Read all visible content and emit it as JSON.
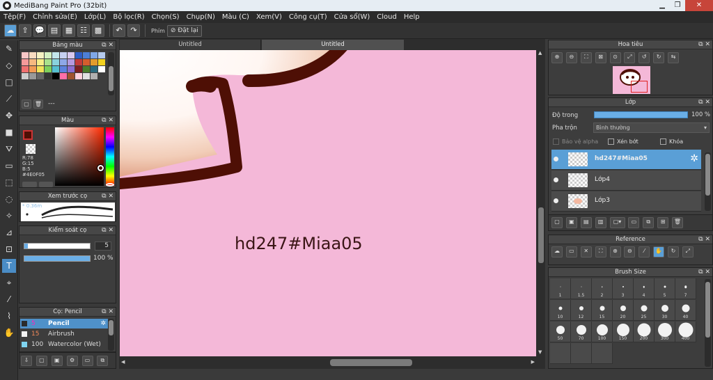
{
  "app": {
    "title": "MediBang Paint Pro (32bit)"
  },
  "window_controls": {
    "minimize": "▁",
    "restore": "❐",
    "close": "✕"
  },
  "menu": [
    "Tệp(F)",
    "Chỉnh sửa(E)",
    "Lớp(L)",
    "Bộ lọc(R)",
    "Chọn(S)",
    "Chụp(N)",
    "Màu (C)",
    "Xem(V)",
    "Công cụ(T)",
    "Cửa sổ(W)",
    "Cloud",
    "Help"
  ],
  "toolbar": {
    "phim_label": "Phím",
    "reset_label": "Đặt lại"
  },
  "panels": {
    "swatch": "Bảng màu",
    "color": "Màu",
    "brush_preview": "Xem trước cọ",
    "brush_control": "Kiểm soát cọ",
    "brush_list": "Cọ: Pencil",
    "navigator": "Hoa tiêu",
    "layer": "Lớp",
    "reference": "Reference",
    "brush_size": "Brush Size"
  },
  "swatches": [
    "#f9c8c8",
    "#f9dcc0",
    "#f6f2c3",
    "#d4f0c2",
    "#c3e6ec",
    "#c6d0f1",
    "#d9c9ee",
    "#2f5ec6",
    "#4d7fd6",
    "#7fa7e6",
    "#b6cbef",
    "#f69a9a",
    "#f7b980",
    "#f6ee88",
    "#a9e28c",
    "#89d2dd",
    "#8ea8e8",
    "#b59ae0",
    "#c13a3a",
    "#d45d2d",
    "#e29c2d",
    "#f2d21f",
    "#f07070",
    "#f29b55",
    "#f2e35a",
    "#7ed15c",
    "#55bfd0",
    "#5c82de",
    "#8d6ed2",
    "#7c1f1f",
    "#4a7d2b",
    "#2a6b7e",
    "#ffffff",
    "#cccccc",
    "#999999",
    "#666666",
    "#333333",
    "#000000",
    "#ff6fa8",
    "#a0522d",
    "#ffd1dc",
    "#e0e0e0",
    "#b0b0b0"
  ],
  "swatch_footer": "---",
  "color": {
    "fg": "#4E0F05",
    "r": "R:78",
    "g": "G:15",
    "b": "B:5",
    "hex": "#4E0F05",
    "bg_swatch": "transparent"
  },
  "brush_preview": {
    "size_text": "0.36m"
  },
  "brush_control": {
    "size": "5",
    "opacity": "100 %",
    "size_fraction": 0.05,
    "opacity_fraction": 1.0
  },
  "brushes": [
    {
      "num": "5",
      "name": "Pencil",
      "color": "#2b2b2b",
      "selected": true
    },
    {
      "num": "15",
      "name": "Airbrush",
      "color": "#f2f2f2",
      "selected": false
    },
    {
      "num": "100",
      "name": "Watercolor (Wet)",
      "color": "#7fd4f0",
      "selected": false
    }
  ],
  "tabs": [
    "Untitled",
    "Untitled"
  ],
  "canvas": {
    "text": "hd247#Miaa05",
    "background": "#f4b8d8"
  },
  "layer_panel": {
    "opacity_label": "Độ trong",
    "opacity_value": "100 %",
    "blend_label": "Pha trộn",
    "blend_value": "Bình thường",
    "protect_alpha": "Bảo vệ alpha",
    "clipping": "Xén bớt",
    "lock": "Khóa",
    "layers": [
      {
        "name": "hd247#Miaa05",
        "selected": true
      },
      {
        "name": "Lớp4",
        "selected": false
      },
      {
        "name": "Lớp3",
        "selected": false
      }
    ]
  },
  "brush_sizes": [
    "1",
    "1.5",
    "2",
    "3",
    "4",
    "5",
    "7",
    "10",
    "12",
    "15",
    "20",
    "25",
    "30",
    "40",
    "50",
    "70",
    "100",
    "150",
    "200",
    "300",
    "400",
    "",
    "",
    ""
  ],
  "tools_left": [
    "brush",
    "eraser",
    "rect",
    "fill-line",
    "move",
    "shape-fill",
    "fill",
    "gradient",
    "select-rect",
    "lasso",
    "magic-wand",
    "select-pen",
    "select-eraser",
    "text",
    "bucket",
    "eyedropper",
    "dropper",
    "hand"
  ]
}
